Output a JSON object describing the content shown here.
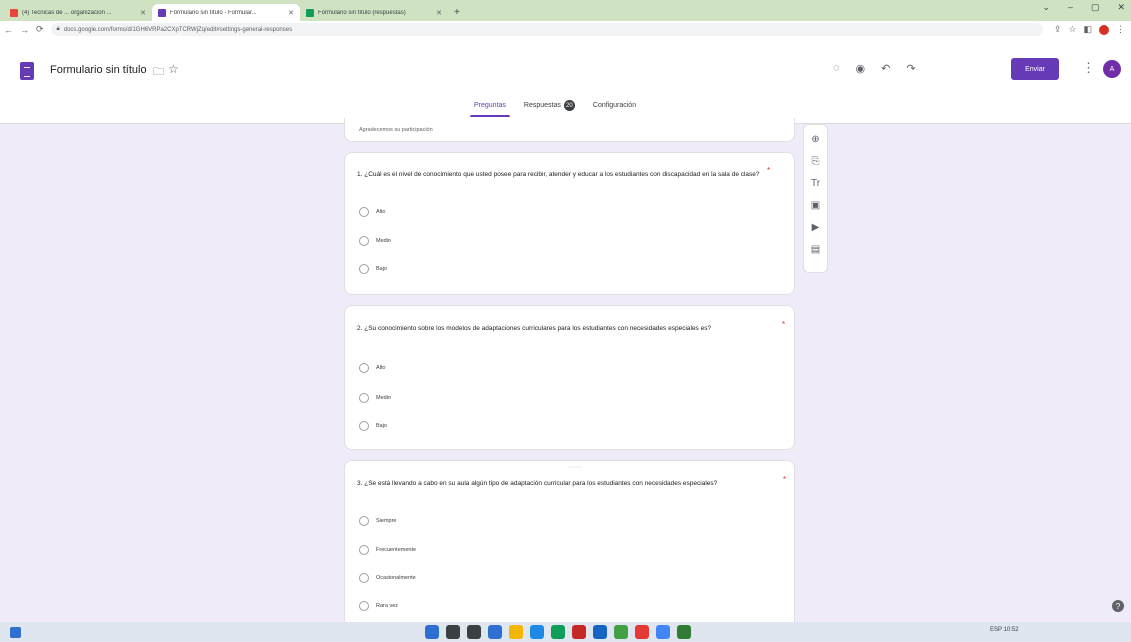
{
  "browser": {
    "tabs": [
      {
        "title": "(4) Tecnicas de ... organizacion ...",
        "favicon_color": "#e8453c"
      },
      {
        "title": "Formulario sin título - Formular...",
        "favicon_color": "#673ab7"
      },
      {
        "title": "Formulario sin título (respuestas)",
        "favicon_color": "#0f9d58"
      }
    ],
    "new_tab": "+",
    "window_controls": [
      "⌄",
      "–",
      "▢",
      "✕"
    ],
    "nav": {
      "back": "←",
      "forward": "→",
      "reload": "⟳"
    },
    "url": "docs.google.com/forms/d/1GH6VRPa2CXpTCRWjZq/edit#settings-general-responses"
  },
  "header": {
    "title": "Formulario sin título",
    "icons": [
      "palette-icon",
      "preview-icon",
      "undo-icon",
      "redo-icon"
    ],
    "icon_glyphs": [
      "◌",
      "◉",
      "↶",
      "↷"
    ],
    "send_label": "Enviar",
    "avatar_initial": "A",
    "tabs": {
      "questions": "Preguntas",
      "responses": "Respuestas",
      "responses_count": "20",
      "settings": "Configuración"
    }
  },
  "form": {
    "description": "Agradecemos su participación",
    "questions": [
      {
        "number_text": "1. ¿Cuál es el nivel de conocimiento que usted posee para recibir, atender y educar a los estudiantes con discapacidad en la sala de clase?",
        "required_mark": "*",
        "options": [
          "Alto",
          "Medio",
          "Bajo"
        ]
      },
      {
        "number_text": "2.   ¿Su conocimiento sobre los modelos de adaptaciones curriculares para los estudiantes con necesidades especiales es?",
        "required_mark": "*",
        "options": [
          "Alto",
          "Medio",
          "Bajo"
        ]
      },
      {
        "number_text": "3.   ¿Se está llevando a cabo en su aula algún tipo de adaptación curricular para los estudiantes con necesidades especiales?",
        "required_mark": "*",
        "options": [
          "Siempre",
          "Frecuentemente",
          "Ocasionalmente",
          "Rara vez"
        ]
      }
    ],
    "drag_handle": "⋯⋯"
  },
  "side_toolbar": [
    {
      "name": "add-question-icon",
      "glyph": "⊕"
    },
    {
      "name": "import-questions-icon",
      "glyph": "⎘"
    },
    {
      "name": "title-text-icon",
      "glyph": "Tr"
    },
    {
      "name": "image-icon",
      "glyph": "▣"
    },
    {
      "name": "video-icon",
      "glyph": "▶"
    },
    {
      "name": "section-icon",
      "glyph": "▤"
    }
  ],
  "taskbar": {
    "app_colors": [
      "#2f6fd1",
      "#3c4043",
      "#3c4043",
      "#2f6fd1",
      "#f4b400",
      "#1e88e5",
      "#0f9d58",
      "#c62828",
      "#1565c0",
      "#43a047",
      "#e53935",
      "#4285f4",
      "#2e7d32"
    ],
    "tray_text": "ESP  10:52"
  },
  "help_glyph": "?"
}
